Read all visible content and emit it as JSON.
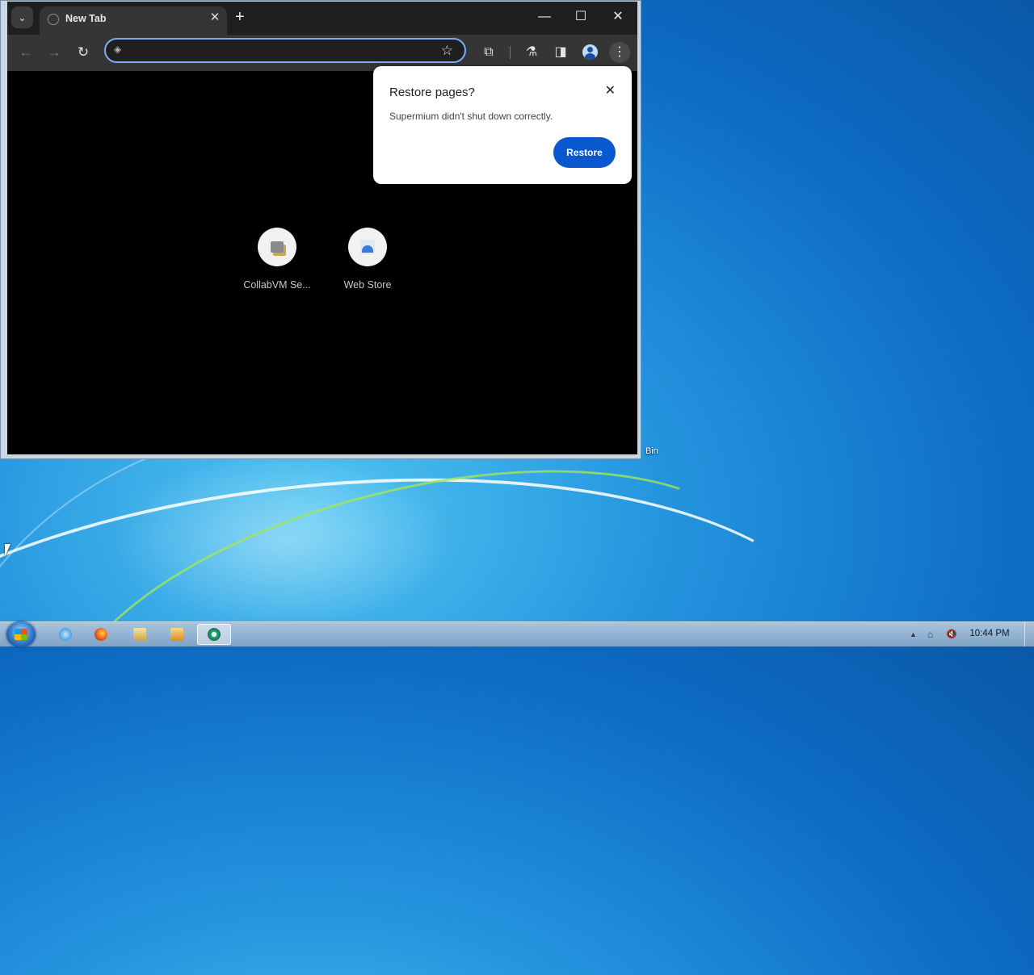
{
  "desktop": {
    "recycle_bin_label_fragment": "Bin"
  },
  "browser": {
    "tab": {
      "title": "New Tab",
      "close_glyph": "✕"
    },
    "tab_search_glyph": "⌄",
    "new_tab_glyph": "+",
    "window_controls": {
      "minimize": "—",
      "maximize": "☐",
      "close": "✕"
    },
    "nav": {
      "back": "←",
      "forward": "→",
      "reload": "↻"
    },
    "omnibox": {
      "value": "",
      "placeholder": "",
      "icon": "page-icon",
      "star_glyph": "☆"
    },
    "toolbar_icons": {
      "extensions": "⧉",
      "labs": "⚗",
      "side_panel": "◨",
      "menu": "⋮"
    },
    "shortcuts": [
      {
        "label": "CollabVM Se...",
        "icon": "collabvm-icon"
      },
      {
        "label": "Web Store",
        "icon": "web-store-icon"
      }
    ],
    "restore_popup": {
      "title": "Restore pages?",
      "message": "Supermium didn't shut down correctly.",
      "button": "Restore",
      "close_glyph": "✕"
    }
  },
  "taskbar": {
    "apps": [
      "internet-explorer",
      "firefox",
      "file-explorer",
      "media-player",
      "supermium"
    ],
    "active_app": "supermium",
    "tray": {
      "expand_glyph": "▲",
      "network_glyph": "⌂",
      "volume_glyph": "🔇"
    },
    "clock": "10:44 PM"
  },
  "colors": {
    "accent": "#0b57d0",
    "omnibox_focus": "#7cacf8",
    "browser_dark": "#353535"
  }
}
